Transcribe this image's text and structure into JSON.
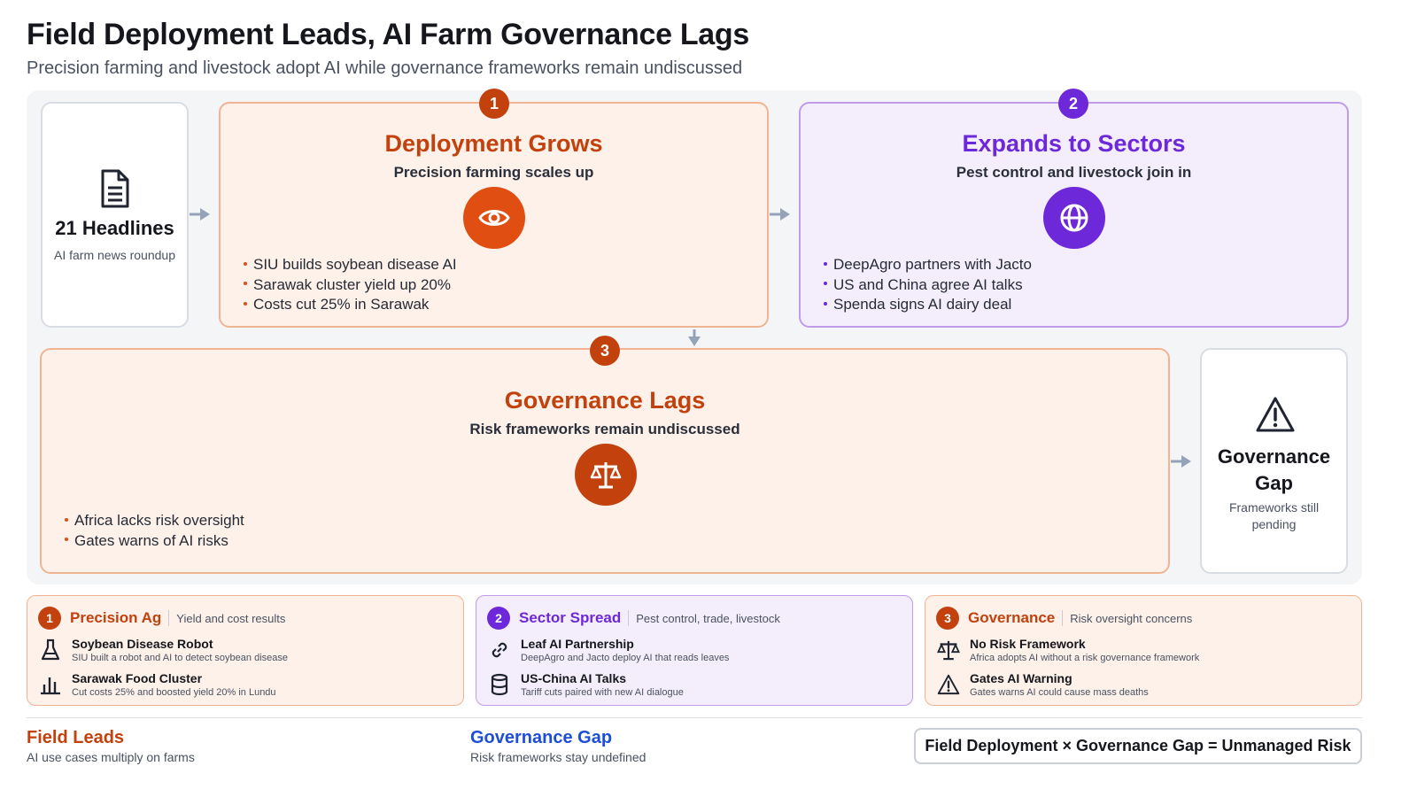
{
  "header": {
    "title": "Field Deployment Leads, AI Farm Governance Lags",
    "subtitle": "Precision farming and livestock adopt AI while governance frameworks remain undiscussed"
  },
  "colors": {
    "orange": "#c2410c",
    "orange_bright": "#e04e12",
    "purple": "#6d28d9",
    "blue": "#1d4ed8",
    "arrow": "#94a3b8"
  },
  "source": {
    "count": "21 Headlines",
    "caption": "AI farm news roundup",
    "icon": "document-icon"
  },
  "stages": [
    {
      "number": "1",
      "title": "Deployment Grows",
      "subtitle": "Precision farming scales up",
      "icon": "eye-icon",
      "bullets": [
        "SIU builds soybean disease AI",
        "Sarawak cluster yield up 20%",
        "Costs cut 25% in Sarawak"
      ]
    },
    {
      "number": "2",
      "title": "Expands to Sectors",
      "subtitle": "Pest control and livestock join in",
      "icon": "globe-icon",
      "bullets": [
        "DeepAgro partners with Jacto",
        "US and China agree AI talks",
        "Spenda signs AI dairy deal"
      ]
    },
    {
      "number": "3",
      "title": "Governance Lags",
      "subtitle": "Risk frameworks remain undiscussed",
      "icon": "scales-icon",
      "bullets": [
        "Africa lacks risk oversight",
        "Gates warns of AI risks"
      ]
    }
  ],
  "outcome": {
    "title_line1": "Governance",
    "title_line2": "Gap",
    "caption_line1": "Frameworks still",
    "caption_line2": "pending",
    "icon": "warning-icon"
  },
  "legend": [
    {
      "number": "1",
      "name": "Precision Ag",
      "desc": "Yield and cost results",
      "items": [
        {
          "icon": "flask-icon",
          "title": "Soybean Disease Robot",
          "detail": "SIU built a robot and AI to detect soybean disease"
        },
        {
          "icon": "bar-chart-icon",
          "title": "Sarawak Food Cluster",
          "detail": "Cut costs 25% and boosted yield 20% in Lundu"
        }
      ]
    },
    {
      "number": "2",
      "name": "Sector Spread",
      "desc": "Pest control, trade, livestock",
      "items": [
        {
          "icon": "link-icon",
          "title": "Leaf AI Partnership",
          "detail": "DeepAgro and Jacto deploy AI that reads leaves"
        },
        {
          "icon": "database-icon",
          "title": "US-China AI Talks",
          "detail": "Tariff cuts paired with new AI dialogue"
        }
      ]
    },
    {
      "number": "3",
      "name": "Governance",
      "desc": "Risk oversight concerns",
      "items": [
        {
          "icon": "scales-icon",
          "title": "No Risk Framework",
          "detail": "Africa adopts AI without a risk governance framework"
        },
        {
          "icon": "warning-icon",
          "title": "Gates AI Warning",
          "detail": "Gates warns AI could cause mass deaths"
        }
      ]
    }
  ],
  "footer": {
    "left_title": "Field Leads",
    "left_sub": "AI use cases multiply on farms",
    "mid_title": "Governance Gap",
    "mid_sub": "Risk frameworks stay undefined",
    "formula": "Field Deployment × Governance Gap = Unmanaged Risk"
  }
}
